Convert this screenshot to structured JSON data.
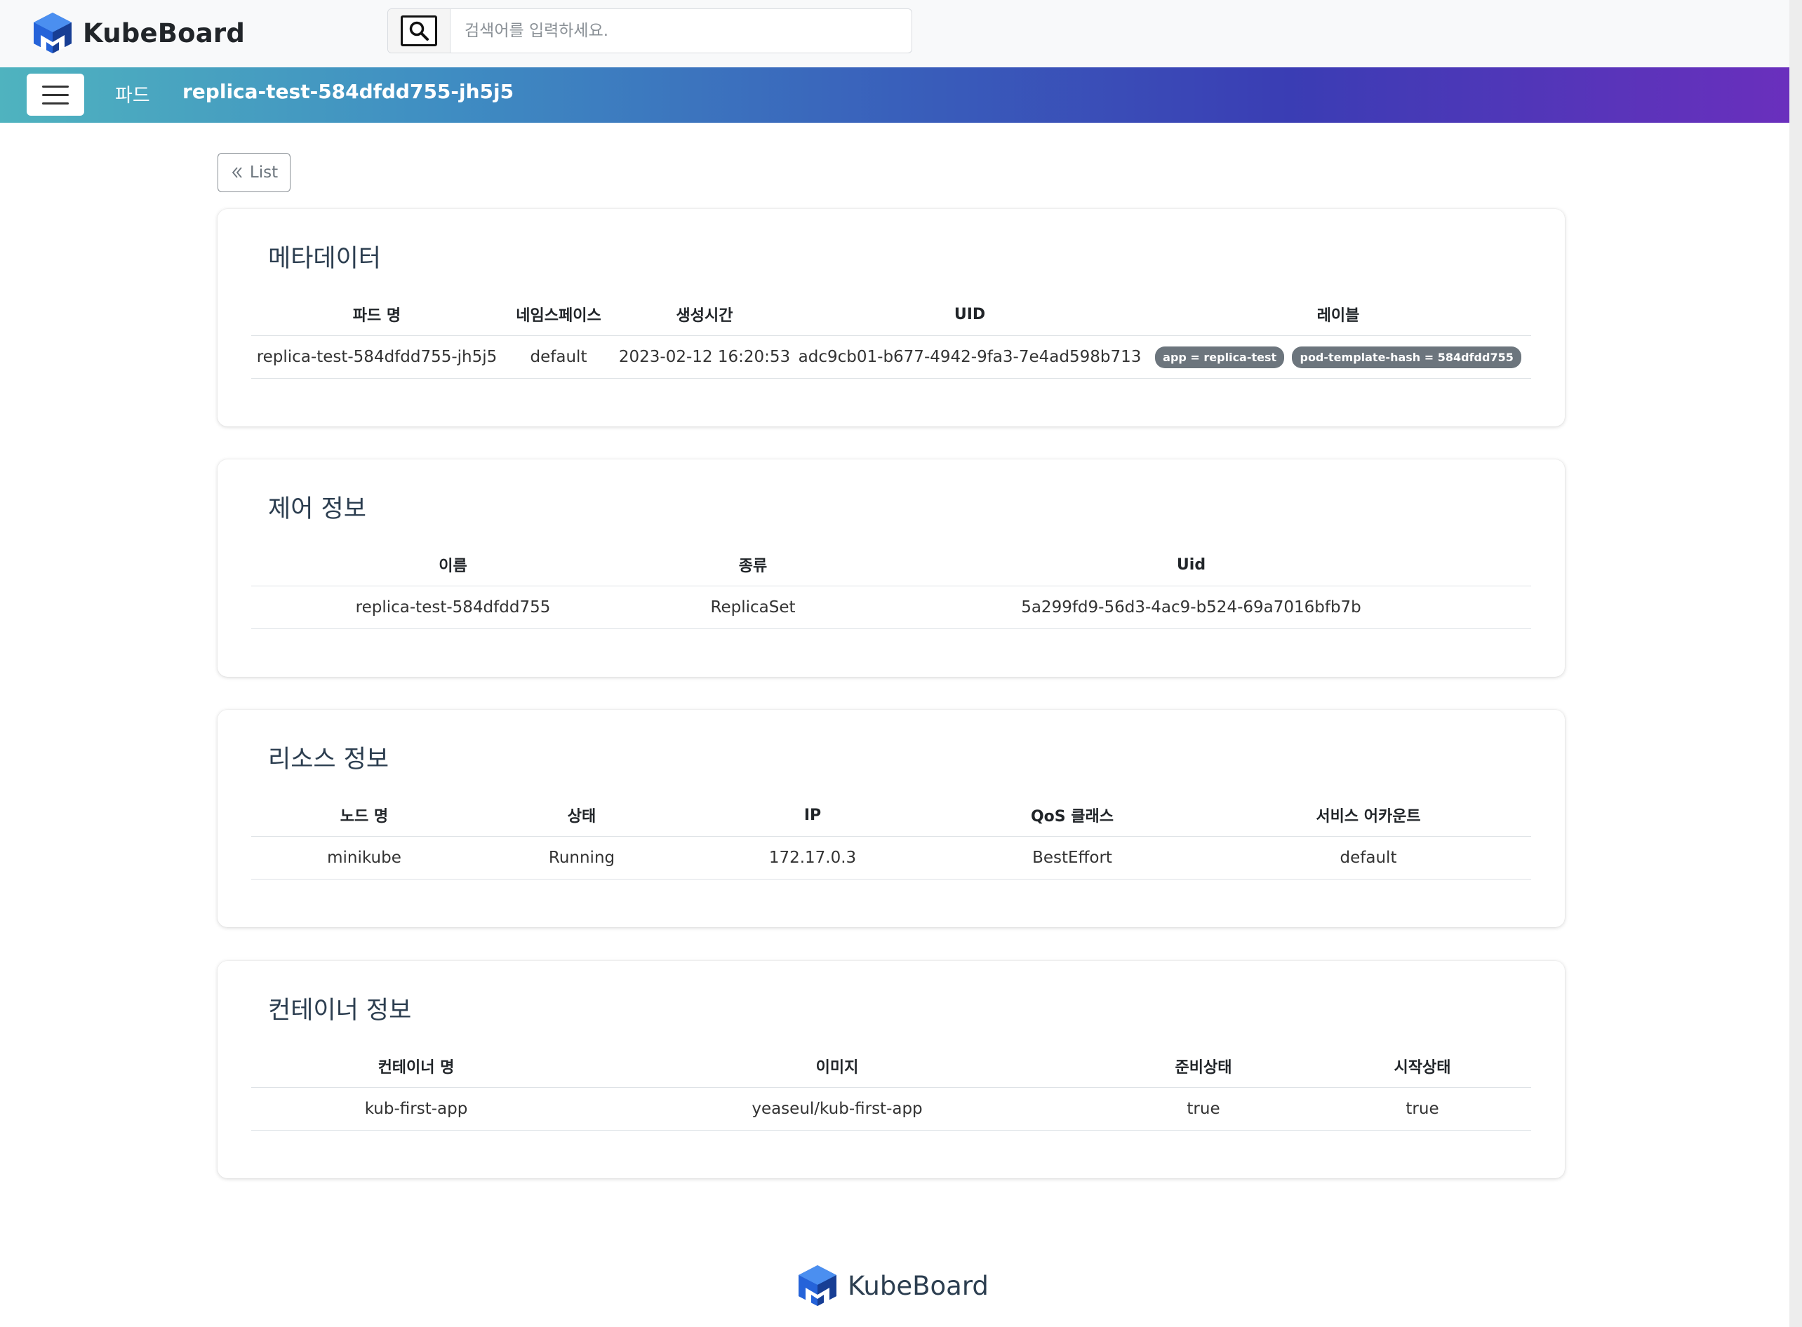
{
  "app": {
    "brand": "KubeBoard"
  },
  "search": {
    "placeholder": "검색어를 입력하세요."
  },
  "header": {
    "section": "파드",
    "title": "replica-test-584dfdd755-jh5j5"
  },
  "nav": {
    "list_label": "List"
  },
  "metadata": {
    "title": "메타데이터",
    "columns": [
      "파드 명",
      "네임스페이스",
      "생성시간",
      "UID",
      "레이블"
    ],
    "row": {
      "name": "replica-test-584dfdd755-jh5j5",
      "namespace": "default",
      "created": "2023-02-12 16:20:53",
      "uid": "adc9cb01-b677-4942-9fa3-7e4ad598b713",
      "labels": [
        "app = replica-test",
        "pod-template-hash = 584dfdd755"
      ]
    }
  },
  "control": {
    "title": "제어 정보",
    "columns": [
      "이름",
      "종류",
      "Uid"
    ],
    "row": {
      "name": "replica-test-584dfdd755",
      "kind": "ReplicaSet",
      "uid": "5a299fd9-56d3-4ac9-b524-69a7016bfb7b"
    }
  },
  "resource": {
    "title": "리소스 정보",
    "columns": [
      "노드 명",
      "상태",
      "IP",
      "QoS 클래스",
      "서비스 어카운트"
    ],
    "row": {
      "node": "minikube",
      "status": "Running",
      "ip": "172.17.0.3",
      "qos": "BestEffort",
      "service_account": "default"
    }
  },
  "container": {
    "title": "컨테이너 정보",
    "columns": [
      "컨테이너 명",
      "이미지",
      "준비상태",
      "시작상태"
    ],
    "row": {
      "name": "kub-first-app",
      "image": "yeaseul/kub-first-app",
      "ready": "true",
      "started": "true"
    }
  },
  "footer": {
    "brand": "KubeBoard"
  },
  "colors": {
    "logo_dark": "#1a3c8f",
    "logo_light": "#3b82f6",
    "badge": "#6c757d"
  }
}
